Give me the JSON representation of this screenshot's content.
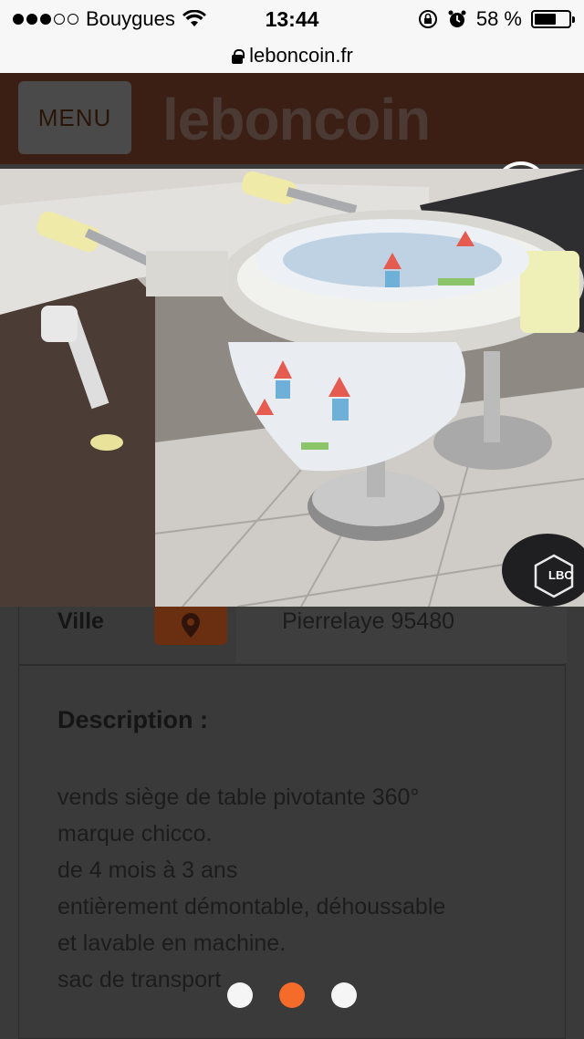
{
  "status_bar": {
    "carrier": "Bouygues",
    "time": "13:44",
    "battery": "58 %",
    "signal_bars": 3
  },
  "url_bar": {
    "url": "leboncoin.fr"
  },
  "header": {
    "menu_label": "MENU",
    "logo_text": "leboncoin"
  },
  "photo": {
    "watermark": "LBC"
  },
  "details": {
    "ville_label": "Ville",
    "ville_value": "Pierrelaye 95480"
  },
  "description": {
    "title": "Description :",
    "lines": [
      "vends siège de table pivotante 360°",
      "marque chicco.",
      "de 4 mois à 3 ans",
      "entièrement démontable, déhoussable",
      "et lavable en machine.",
      "sac de transport"
    ]
  },
  "carousel": {
    "count": 3,
    "active_index": 1
  },
  "colors": {
    "accent": "#f56b2a",
    "header_bg": "#3b1f14"
  }
}
